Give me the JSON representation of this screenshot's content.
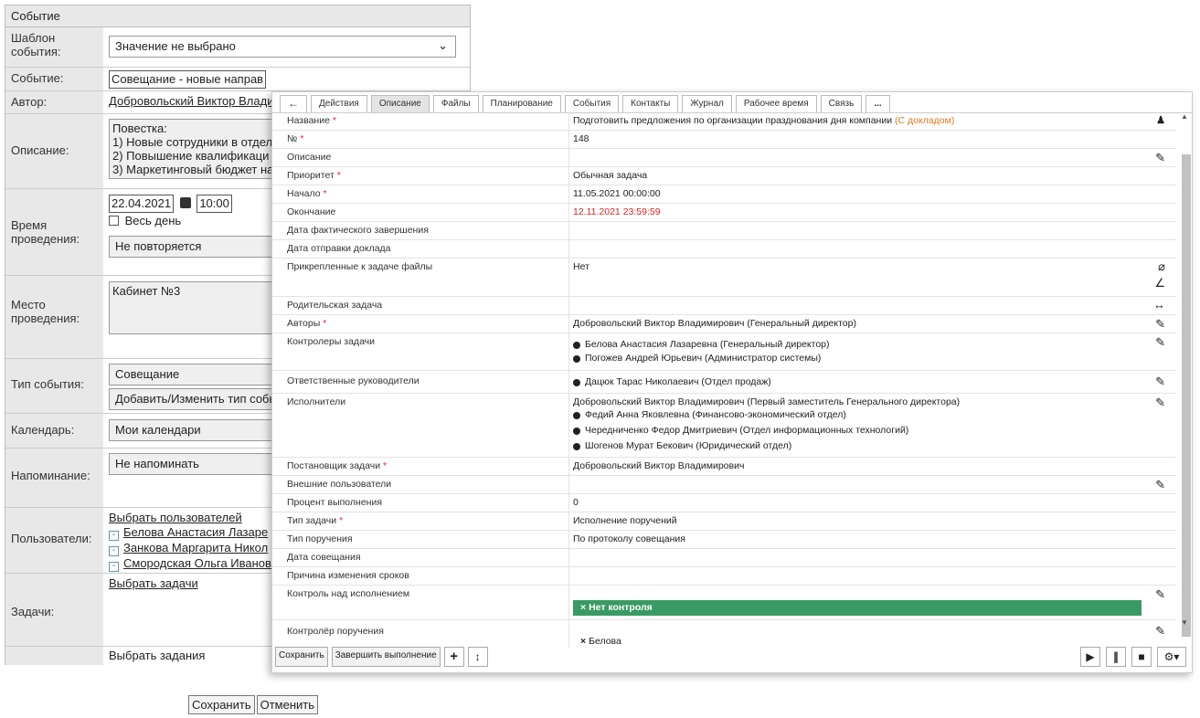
{
  "form": {
    "header": "Событие",
    "template_label": "Шаблон события:",
    "template_value": "Значение не выбрано",
    "event_label": "Событие:",
    "event_value": "Совещание - новые направ",
    "author_label": "Автор:",
    "author_value": "Добровольский Виктор Влади",
    "description_label": "Описание:",
    "description_lines": [
      "Повестка:",
      "1) Новые сотрудники в отдел",
      "2) Повышение квалификаци",
      "3) Маркетинговый бюджет на"
    ],
    "time_label": "Время проведения:",
    "date_value": "22.04.2021",
    "time_value": "10:00",
    "allday_label": "Весь день",
    "repeat_value": "Не повторяется",
    "place_label": "Место проведения:",
    "place_value": "Кабинет №3",
    "type_label": "Тип события:",
    "type_value": "Совещание",
    "type_add": "Добавить/Изменить тип собы",
    "calendar_label": "Календарь:",
    "calendar_value": "Мои календари",
    "reminder_label": "Напоминание:",
    "reminder_value": "Не напоминать",
    "users_label": "Пользователи:",
    "users_select": "Выбрать пользователей",
    "users": [
      "Белова Анастасия Лазаре",
      "Занкова Маргарита Никол",
      "Смородская Ольга Иванов"
    ],
    "tasks_label": "Задачи:",
    "tasks_select": "Выбрать задачи",
    "assign_select": "Выбрать задания",
    "save": "Сохранить",
    "cancel": "Отменить"
  },
  "dialog": {
    "back": "←",
    "tabs": [
      "Действия",
      "Описание",
      "Файлы",
      "Планирование",
      "События",
      "Контакты",
      "Журнал",
      "Рабочее время",
      "Связь",
      "..."
    ],
    "active_tab": "Описание",
    "rows": {
      "name_k": "Название",
      "name_v": "Подготовить предложения по организации празднования дня компании",
      "name_extra": "(С докладом)",
      "num_k": "№",
      "num_v": "148",
      "desc_k": "Описание",
      "prio_k": "Приоритет",
      "prio_v": "Обычная задача",
      "start_k": "Начало",
      "start_v": "11.05.2021 00:00:00",
      "end_k": "Окончание",
      "end_v": "12.11.2021 23:59:59",
      "actual_k": "Дата фактического завершения",
      "report_k": "Дата отправки доклада",
      "files_k": "Прикрепленные к задаче файлы",
      "files_v": "Нет",
      "parent_k": "Родительская задача",
      "authors_k": "Авторы",
      "authors_v": "Добровольский Виктор Владимирович (Генеральный директор)",
      "controllers_k": "Контролеры задачи",
      "controllers": [
        "Белова Анастасия Лазаревна (Генеральный директор)",
        "Погожев Андрей Юрьевич (Администратор системы)"
      ],
      "resp_k": "Ответственные руководители",
      "resp": [
        "Дацюк Тарас Николаевич (Отдел продаж)"
      ],
      "exec_k": "Исполнители",
      "exec_main": "Добровольский Виктор Владимирович (Первый заместитель Генерального директора)",
      "exec": [
        "Федий Анна Яковлевна (Финансово-экономический отдел)",
        "Чередниченко Федор Дмитриевич (Отдел информационных технологий)",
        "Шогенов Мурат Бекович (Юридический отдел)"
      ],
      "setter_k": "Постановщик задачи",
      "setter_v": "Добровольский Виктор Владимирович",
      "ext_k": "Внешние пользователи",
      "pct_k": "Процент выполнения",
      "pct_v": "0",
      "ttype_k": "Тип задачи",
      "ttype_v": "Исполнение поручений",
      "otype_k": "Тип поручения",
      "otype_v": "По протоколу совещания",
      "meetdate_k": "Дата совещания",
      "reason_k": "Причина изменения сроков",
      "control_k": "Контроль над исполнением",
      "control_v": "Нет контроля",
      "ocontroller_k": "Контролёр поручения",
      "ocontroller_v": "Белова"
    },
    "save": "Сохранить",
    "finish": "Завершить выполнение"
  },
  "colors": {
    "required": "#e23232",
    "orange": "#e07a1f",
    "deadline": "#e32020",
    "green_bar": "#3a9a63"
  }
}
